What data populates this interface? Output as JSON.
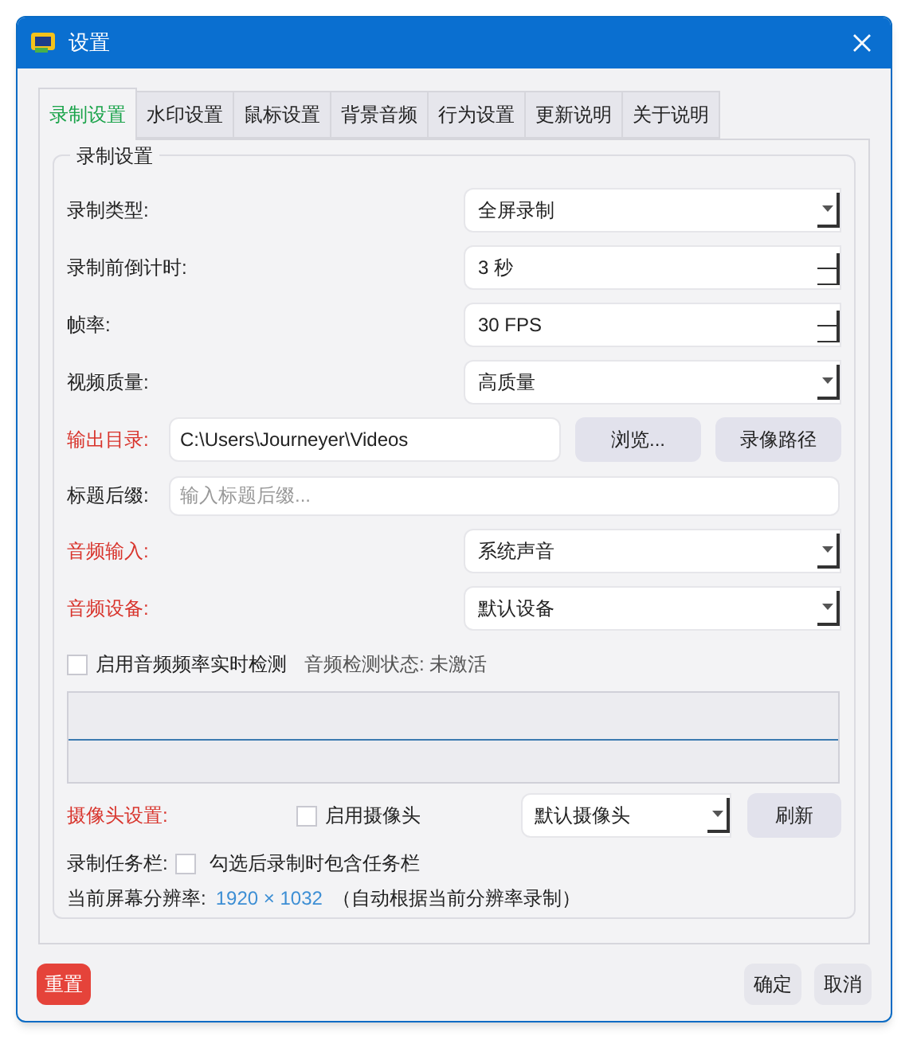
{
  "window": {
    "title": "设置"
  },
  "tabs": [
    {
      "label": "录制设置",
      "selected": true
    },
    {
      "label": "水印设置",
      "selected": false
    },
    {
      "label": "鼠标设置",
      "selected": false
    },
    {
      "label": "背景音频",
      "selected": false
    },
    {
      "label": "行为设置",
      "selected": false
    },
    {
      "label": "更新说明",
      "selected": false
    },
    {
      "label": "关于说明",
      "selected": false
    }
  ],
  "group": {
    "title": "录制设置"
  },
  "settings": [
    {
      "kind": "select",
      "label": "录制类型:",
      "highlighted": false,
      "value": "全屏录制"
    },
    {
      "kind": "spinner",
      "label": "录制前倒计时:",
      "highlighted": false,
      "value": "3 秒"
    },
    {
      "kind": "spinner",
      "label": "帧率:",
      "highlighted": false,
      "value": "30 FPS"
    },
    {
      "kind": "select",
      "label": "视频质量:",
      "highlighted": false,
      "value": "高质量"
    },
    {
      "kind": "path",
      "label": "输出目录:",
      "highlighted": true,
      "value": "C:\\Users\\Journeyer\\Videos",
      "buttons": [
        "浏览...",
        "录像路径"
      ]
    },
    {
      "kind": "text",
      "label": "标题后缀:",
      "highlighted": false,
      "placeholder": "输入标题后缀..."
    },
    {
      "kind": "select",
      "label": "音频输入:",
      "highlighted": true,
      "value": "系统声音"
    },
    {
      "kind": "select",
      "label": "音频设备:",
      "highlighted": true,
      "value": "默认设备"
    },
    {
      "kind": "detect",
      "checked": false,
      "checkbox_label": "启用音频频率实时检测",
      "status": "音频检测状态: 未激活"
    },
    {
      "kind": "spectrum"
    },
    {
      "kind": "camera",
      "label": "摄像头设置:",
      "highlighted": true,
      "checked": false,
      "checkbox_label": "启用摄像头",
      "value": "默认摄像头",
      "button": "刷新"
    },
    {
      "kind": "taskbar",
      "label": "录制任务栏:",
      "highlighted": false,
      "checked": false,
      "checkbox_label": "勾选后录制时包含任务栏"
    },
    {
      "kind": "resolution",
      "label": "当前屏幕分辨率:",
      "highlighted": false,
      "value": "1920 × 1032",
      "note": "（自动根据当前分辨率录制）"
    }
  ],
  "footer": {
    "reset": "重置",
    "buttons": [
      "确定",
      "取消"
    ]
  }
}
